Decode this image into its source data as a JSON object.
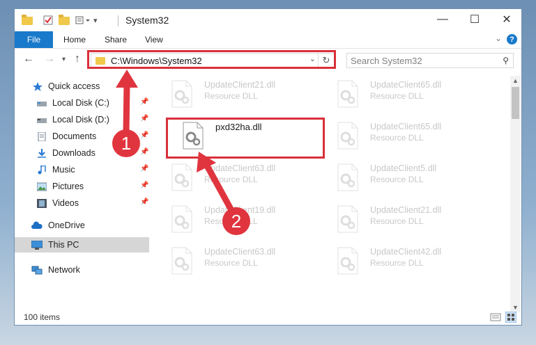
{
  "window": {
    "title": "System32",
    "controls": {
      "minimize": "—",
      "maximize": "☐",
      "close": "✕"
    }
  },
  "ribbon": {
    "tabs": [
      "File",
      "Home",
      "Share",
      "View"
    ]
  },
  "address_bar": {
    "path": "C:\\Windows\\System32",
    "search_placeholder": "Search System32"
  },
  "sidebar": {
    "items": [
      {
        "label": "Quick access",
        "icon": "star-icon",
        "pinned": false
      },
      {
        "label": "Local Disk (C:)",
        "icon": "drive-icon",
        "pinned": true
      },
      {
        "label": "Local Disk (D:)",
        "icon": "drive-icon",
        "pinned": true
      },
      {
        "label": "Documents",
        "icon": "documents-icon",
        "pinned": true
      },
      {
        "label": "Downloads",
        "icon": "download-icon",
        "pinned": true
      },
      {
        "label": "Music",
        "icon": "music-icon",
        "pinned": true
      },
      {
        "label": "Pictures",
        "icon": "pictures-icon",
        "pinned": true
      },
      {
        "label": "Videos",
        "icon": "videos-icon",
        "pinned": true
      },
      {
        "label": "OneDrive",
        "icon": "cloud-icon",
        "pinned": false
      },
      {
        "label": "This PC",
        "icon": "computer-icon",
        "pinned": false,
        "selected": true
      },
      {
        "label": "Network",
        "icon": "network-icon",
        "pinned": false
      }
    ]
  },
  "files": [
    {
      "name": "UpdateClient21.dll",
      "type": "Resource DLL",
      "faded": true
    },
    {
      "name": "UpdateClient65.dll",
      "type": "Resource DLL",
      "faded": true
    },
    {
      "name": "pxd32ha.dll",
      "type": "",
      "faded": false,
      "highlighted": true
    },
    {
      "name": "UpdateClient65.dll",
      "type": "Resource DLL",
      "faded": true
    },
    {
      "name": "UpdateClient63.dll",
      "type": "Resource DLL",
      "faded": true
    },
    {
      "name": "UpdateClient5.dll",
      "type": "Resource DLL",
      "faded": true
    },
    {
      "name": "UpdateClient19.dll",
      "type": "Resource DLL",
      "faded": true
    },
    {
      "name": "UpdateClient21.dll",
      "type": "Resource DLL",
      "faded": true
    },
    {
      "name": "UpdateClient63.dll",
      "type": "Resource DLL",
      "faded": true
    },
    {
      "name": "UpdateClient42.dll",
      "type": "Resource DLL",
      "faded": true
    }
  ],
  "status": {
    "item_count": "100 items"
  },
  "annotations": [
    {
      "number": "1",
      "target": "address-bar"
    },
    {
      "number": "2",
      "target": "pxd32ha.dll"
    }
  ],
  "colors": {
    "accent": "#1979ca",
    "annotation": "#d9303a"
  }
}
